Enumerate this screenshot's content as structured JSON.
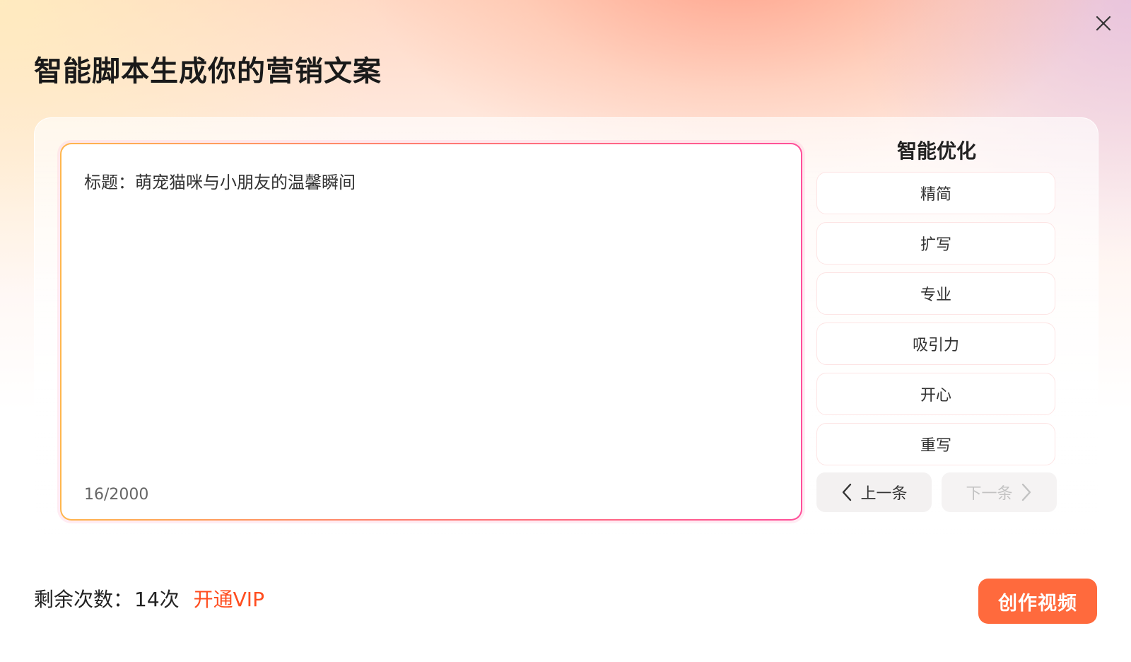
{
  "dialog": {
    "title": "智能脚本生成你的营销文案",
    "close_icon": "close-icon"
  },
  "editor": {
    "content": "标题：萌宠猫咪与小朋友的温馨瞬间",
    "char_count": "16/2000"
  },
  "optimize": {
    "title": "智能优化",
    "options": [
      {
        "label": "精简"
      },
      {
        "label": "扩写"
      },
      {
        "label": "专业"
      },
      {
        "label": "吸引力"
      },
      {
        "label": "开心"
      },
      {
        "label": "重写"
      }
    ],
    "prev_label": "上一条",
    "next_label": "下一条",
    "prev_icon": "chevron-left-icon",
    "next_icon": "chevron-right-icon"
  },
  "footer": {
    "remaining_label": "剩余次数：",
    "remaining_count": "14次",
    "vip_label": "开通VIP",
    "create_label": "创作视频"
  },
  "colors": {
    "accent": "#ff6a3d",
    "vip_text": "#ff4d1f",
    "editor_border_start": "#ffb64d",
    "editor_border_end": "#ff4f9a"
  }
}
